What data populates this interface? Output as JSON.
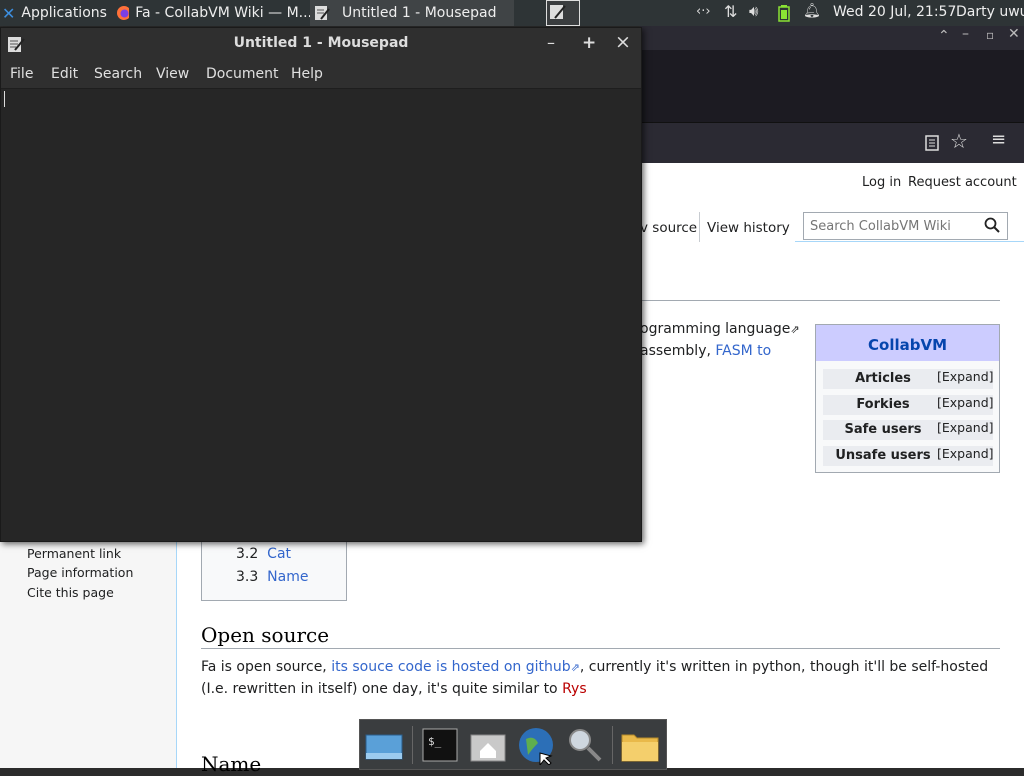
{
  "top_panel": {
    "applications_label": "Applications",
    "tasks": [
      {
        "label": "Fa - CollabVM Wiki — M..."
      },
      {
        "label": "Untitled 1 - Mousepad"
      }
    ],
    "clock": "Wed 20 Jul, 21:57",
    "user": "Darty uwu"
  },
  "firefox": {
    "header_links": {
      "login": "Log in",
      "request_account": "Request account"
    },
    "tabs": {
      "view_source": "v source",
      "view_history": "View history"
    },
    "search": {
      "placeholder": "Search CollabVM Wiki"
    }
  },
  "wiki": {
    "intro_fragment_1": "ogramming language",
    "intro_fragment_2": "assembly,",
    "intro_link": "FASM to",
    "infobox": {
      "title": "CollabVM",
      "rows": [
        {
          "label": "Articles",
          "action": "[Expand]"
        },
        {
          "label": "Forkies",
          "action": "[Expand]"
        },
        {
          "label": "Safe users",
          "action": "[Expand]"
        },
        {
          "label": "Unsafe users",
          "action": "[Expand]"
        }
      ]
    },
    "sidebar_links": [
      "Permanent link",
      "Page information",
      "Cite this page"
    ],
    "toc": [
      {
        "num": "3.2",
        "label": "Cat"
      },
      {
        "num": "3.3",
        "label": "Name"
      }
    ],
    "section_open_source": {
      "heading": "Open source",
      "text_1": "Fa is open source, ",
      "link": "its souce code is hosted on github",
      "text_2": ", currently it's written in python, though it'll be self-hosted",
      "text_3": "(I.e. rewritten in itself) one day, it's quite similar to ",
      "red_link": "Rys"
    },
    "section_name_heading": "Name"
  },
  "mousepad": {
    "title": "Untitled 1 - Mousepad",
    "menu": [
      "File",
      "Edit",
      "Search",
      "View",
      "Document",
      "Help"
    ],
    "buttons": {
      "minimize": "–",
      "maximize": "+",
      "close": "×"
    }
  }
}
